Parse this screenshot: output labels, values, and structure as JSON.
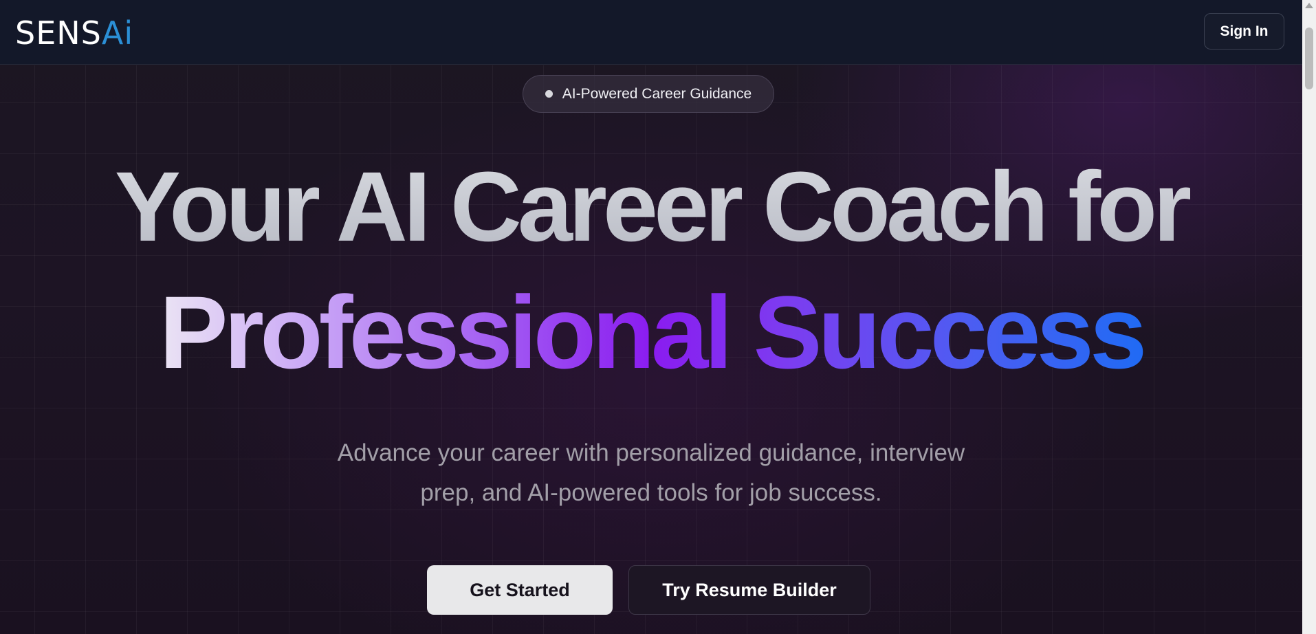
{
  "header": {
    "logo_text_white": "SENS",
    "logo_text_blue": "Ai",
    "signin_label": "Sign In"
  },
  "hero": {
    "badge_label": "AI-Powered Career Guidance",
    "headline_line1": "Your AI Career Coach for",
    "headline_line2": "Professional Success",
    "subtitle_line1": "Advance your career with personalized guidance, interview",
    "subtitle_line2": "prep, and AI-powered tools for job success.",
    "primary_button_label": "Get Started",
    "secondary_button_label": "Try Resume Builder"
  },
  "colors": {
    "header_bg": "#131829",
    "logo_blue": "#2b8fd6",
    "gradient_start": "#ece6f4",
    "gradient_mid": "#8a1cf0",
    "gradient_end": "#1f6bf4",
    "primary_button_bg": "#e8e8ea"
  },
  "icons": {
    "badge_dot": "dot-icon",
    "scroll_up": "scroll-up-arrow-icon"
  }
}
